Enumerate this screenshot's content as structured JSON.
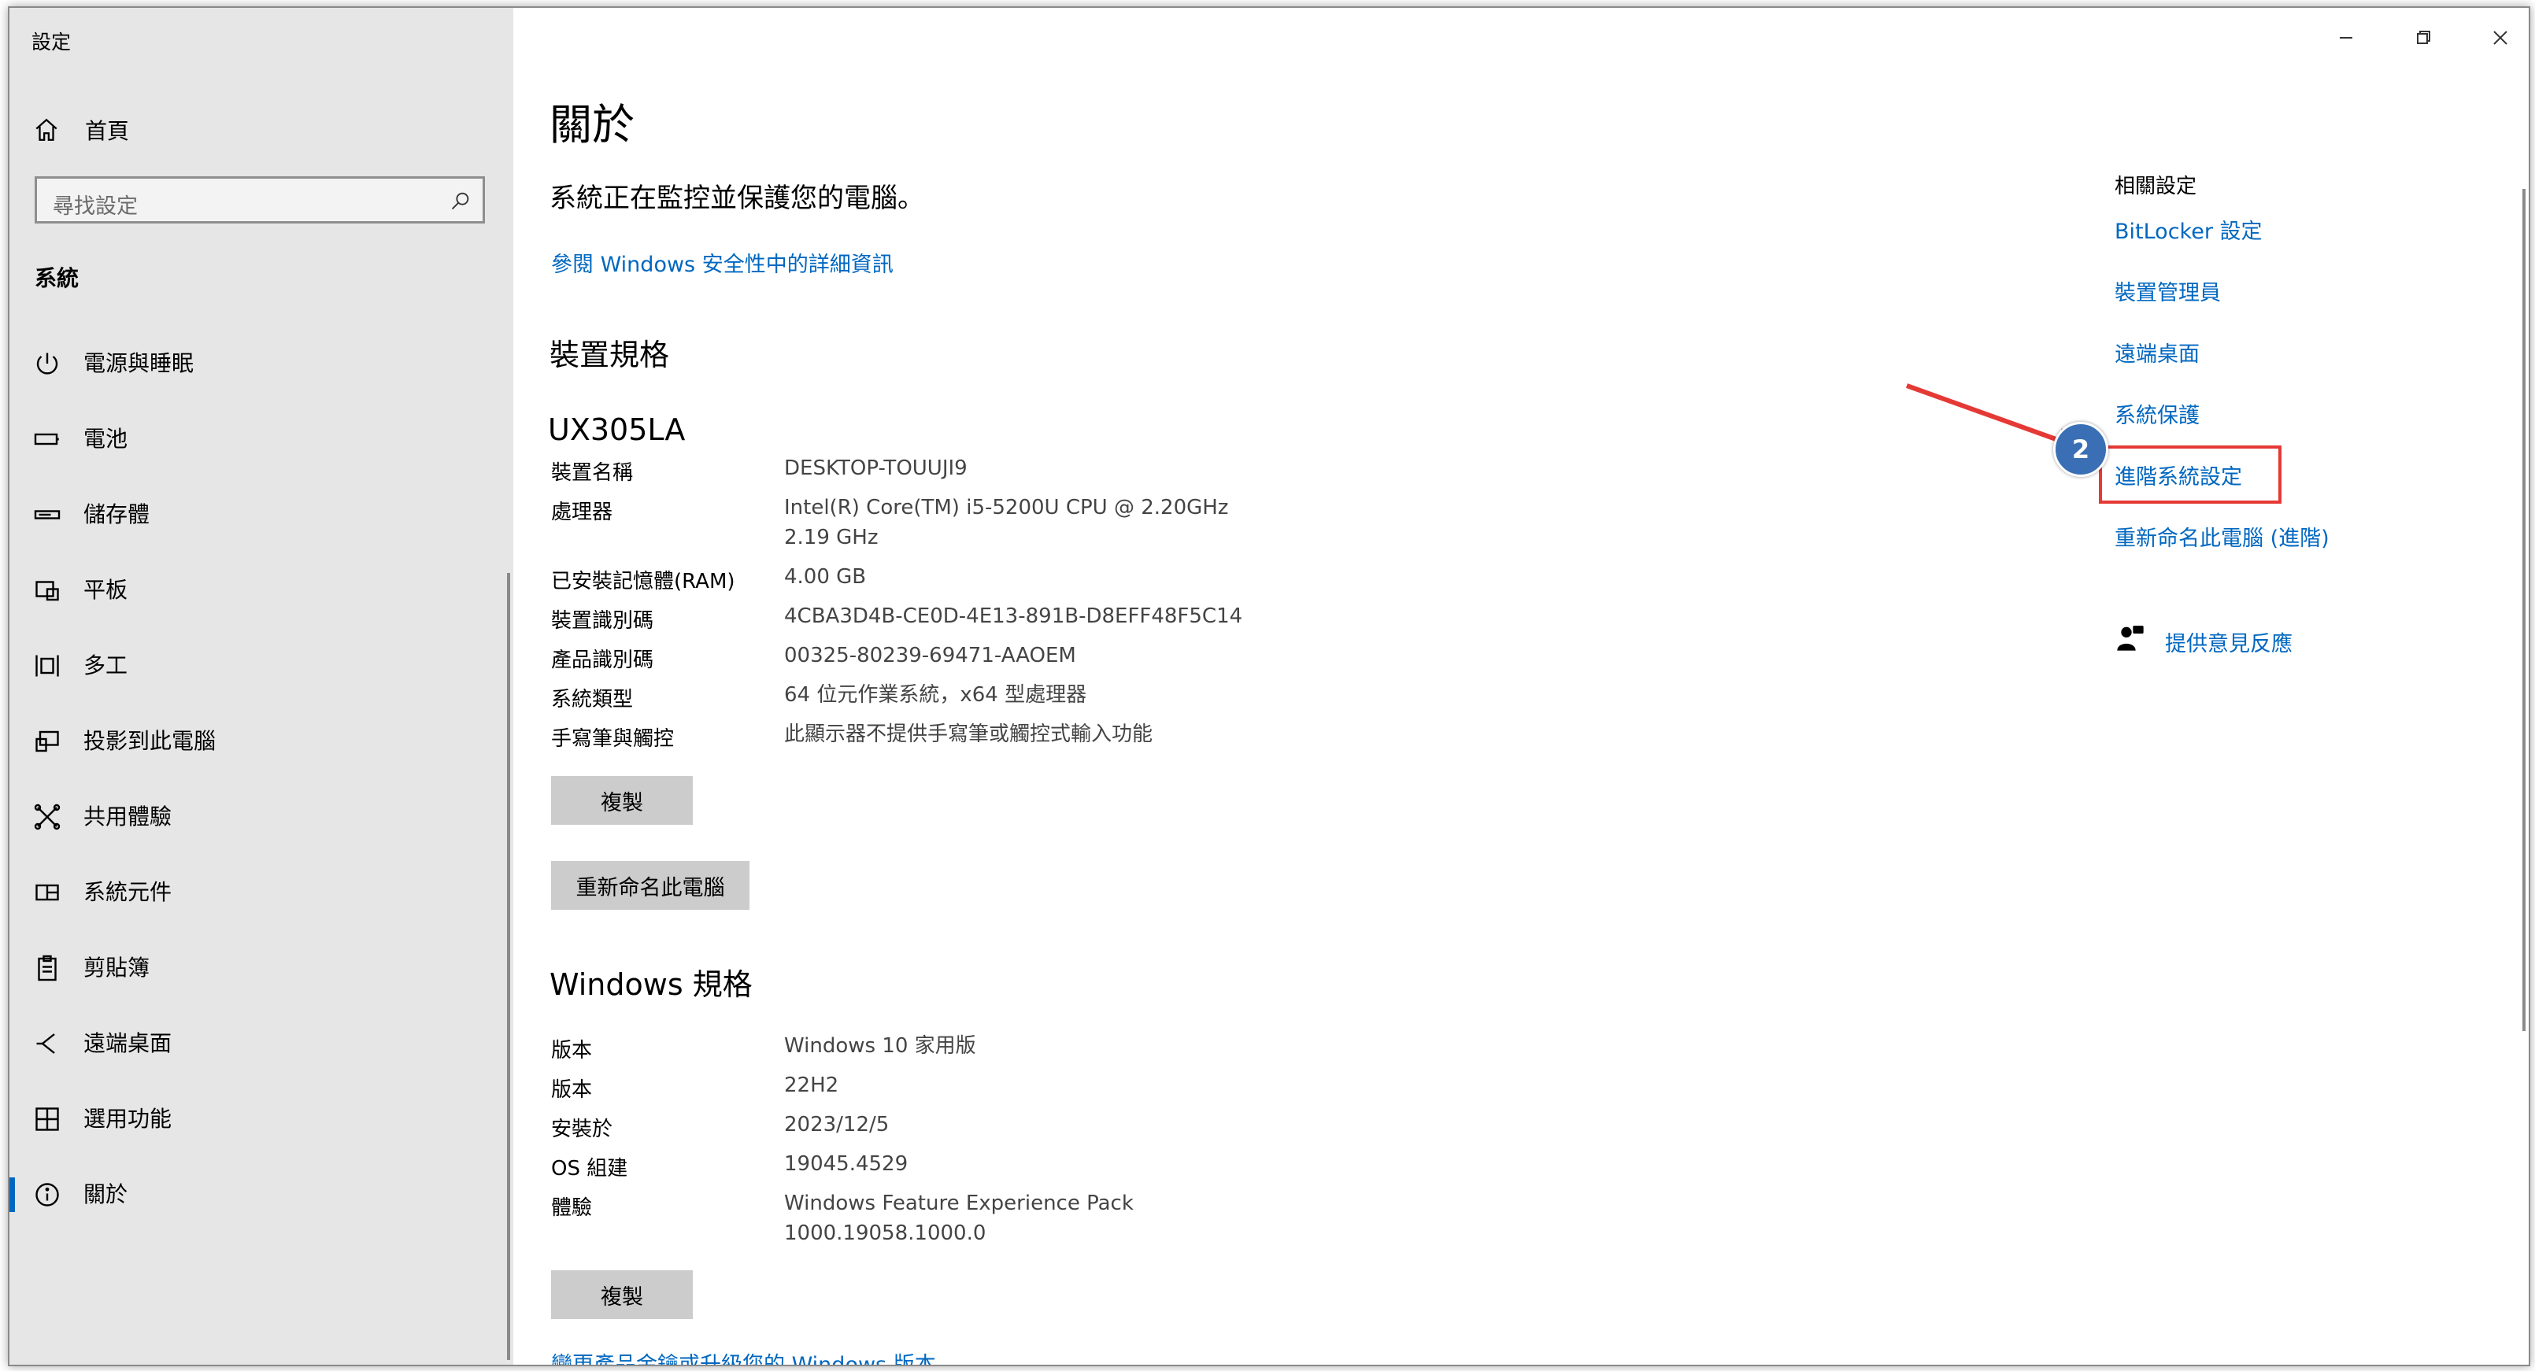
{
  "window": {
    "title": "設定"
  },
  "sidebar": {
    "home_label": "首頁",
    "search_placeholder": "尋找設定",
    "section_title": "系統",
    "items": [
      {
        "label": "電源與睡眠",
        "icon": "power-icon"
      },
      {
        "label": "電池",
        "icon": "battery-icon"
      },
      {
        "label": "儲存體",
        "icon": "storage-icon"
      },
      {
        "label": "平板",
        "icon": "tablet-icon"
      },
      {
        "label": "多工",
        "icon": "multitasking-icon"
      },
      {
        "label": "投影到此電腦",
        "icon": "project-icon"
      },
      {
        "label": "共用體驗",
        "icon": "shared-experiences-icon"
      },
      {
        "label": "系統元件",
        "icon": "system-components-icon"
      },
      {
        "label": "剪貼簿",
        "icon": "clipboard-icon"
      },
      {
        "label": "遠端桌面",
        "icon": "remote-desktop-icon"
      },
      {
        "label": "選用功能",
        "icon": "optional-features-icon"
      },
      {
        "label": "關於",
        "icon": "info-icon",
        "active": true
      }
    ]
  },
  "main": {
    "title": "關於",
    "protection_text": "系統正在監控並保護您的電腦。",
    "security_link": "參閱 Windows 安全性中的詳細資訊",
    "device_section_title": "裝置規格",
    "device_model": "UX305LA",
    "device_specs": [
      {
        "label": "裝置名稱",
        "value": "DESKTOP-TOUUJI9"
      },
      {
        "label": "處理器",
        "value": "Intel(R) Core(TM) i5-5200U CPU @ 2.20GHz",
        "value2": "2.19 GHz"
      },
      {
        "label": "已安裝記憶體(RAM)",
        "value": "4.00 GB"
      },
      {
        "label": "裝置識別碼",
        "value": "4CBA3D4B-CE0D-4E13-891B-D8EFF48F5C14"
      },
      {
        "label": "產品識別碼",
        "value": "00325-80239-69471-AAOEM"
      },
      {
        "label": "系統類型",
        "value": "64 位元作業系統，x64 型處理器"
      },
      {
        "label": "手寫筆與觸控",
        "value": "此顯示器不提供手寫筆或觸控式輸入功能"
      }
    ],
    "copy_button": "複製",
    "rename_button": "重新命名此電腦",
    "windows_section_title": "Windows 規格",
    "windows_specs": [
      {
        "label": "版本",
        "value": "Windows 10 家用版"
      },
      {
        "label": "版本",
        "value": "22H2"
      },
      {
        "label": "安裝於",
        "value": "2023/12/5"
      },
      {
        "label": "OS 組建",
        "value": "19045.4529"
      },
      {
        "label": "體驗",
        "value": "Windows Feature Experience Pack",
        "value2": "1000.19058.1000.0"
      }
    ],
    "copy_button_2": "複製",
    "bottom_link": "變更產品金鑰或升級您的 Windows 版本"
  },
  "related": {
    "title": "相關設定",
    "links": [
      "BitLocker 設定",
      "裝置管理員",
      "遠端桌面",
      "系統保護",
      "進階系統設定",
      "重新命名此電腦 (進階)"
    ],
    "feedback": "提供意見反應"
  },
  "annotation": {
    "badge_number": "2",
    "accent_color": "#e53935",
    "badge_color": "#3a6fb5"
  },
  "colors": {
    "link": "#0067c0",
    "sidebar_bg": "#e6e6e6",
    "button_bg": "#cccccc"
  }
}
